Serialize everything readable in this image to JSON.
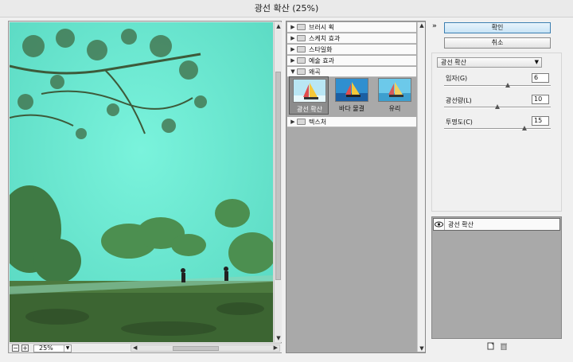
{
  "window": {
    "title": "광선 확산 (25%)"
  },
  "preview": {
    "zoom": "25%",
    "zoom_minus": "−",
    "zoom_plus": "+"
  },
  "gallery": {
    "categories": [
      {
        "label": "브러시 획",
        "expanded": false
      },
      {
        "label": "스케치 효과",
        "expanded": false
      },
      {
        "label": "스타일화",
        "expanded": false
      },
      {
        "label": "예술 효과",
        "expanded": false
      },
      {
        "label": "왜곡",
        "expanded": true
      },
      {
        "label": "텍스처",
        "expanded": false
      }
    ],
    "thumbnails": [
      {
        "label": "광선 확산",
        "selected": true
      },
      {
        "label": "바다 물결",
        "selected": false
      },
      {
        "label": "유리",
        "selected": false
      }
    ]
  },
  "buttons": {
    "ok": "확인",
    "cancel": "취소"
  },
  "filter_select": {
    "value": "광선 확산"
  },
  "params": [
    {
      "label": "입자(G)",
      "value": "6",
      "fraction": 0.6
    },
    {
      "label": "광선량(L)",
      "value": "10",
      "fraction": 0.5
    },
    {
      "label": "투명도(C)",
      "value": "15",
      "fraction": 0.75
    }
  ],
  "layers": [
    {
      "label": "광선 확산"
    }
  ],
  "colors": {
    "accent": "#3c7fb1",
    "preview_bg": "#5fe0c8"
  }
}
